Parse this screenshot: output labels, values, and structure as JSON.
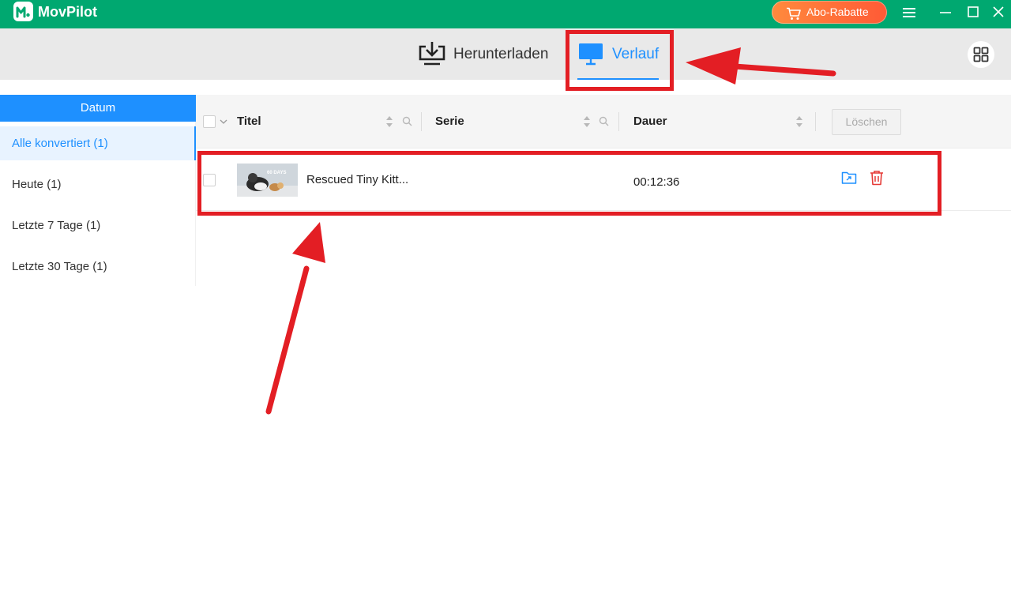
{
  "app": {
    "name": "MovPilot",
    "promo_label": "Abo-Rabatte"
  },
  "tabs": [
    {
      "label": "Herunterladen",
      "active": false
    },
    {
      "label": "Verlauf",
      "active": true
    }
  ],
  "sidebar": {
    "header": "Datum",
    "items": [
      {
        "label": "Alle konvertiert (1)",
        "active": true
      },
      {
        "label": "Heute (1)",
        "active": false
      },
      {
        "label": "Letzte 7 Tage (1)",
        "active": false
      },
      {
        "label": "Letzte 30 Tage (1)",
        "active": false
      }
    ]
  },
  "table": {
    "columns": {
      "title": "Titel",
      "series": "Serie",
      "duration": "Dauer"
    },
    "delete_label": "Löschen",
    "rows": [
      {
        "title": "Rescued Tiny Kitt...",
        "series": "",
        "duration": "00:12:36",
        "thumbnail_caption": "60 DAYS"
      }
    ]
  },
  "colors": {
    "brand_green": "#00a870",
    "accent_blue": "#1e90ff",
    "annotation_red": "#e31e24",
    "promo_orange": "#ff6a3a"
  },
  "icons": {
    "download": "download-tray-icon",
    "history": "monitor-icon",
    "grid": "grid-icon",
    "cart": "cart-icon",
    "folder": "open-folder-icon",
    "trash": "trash-icon"
  }
}
